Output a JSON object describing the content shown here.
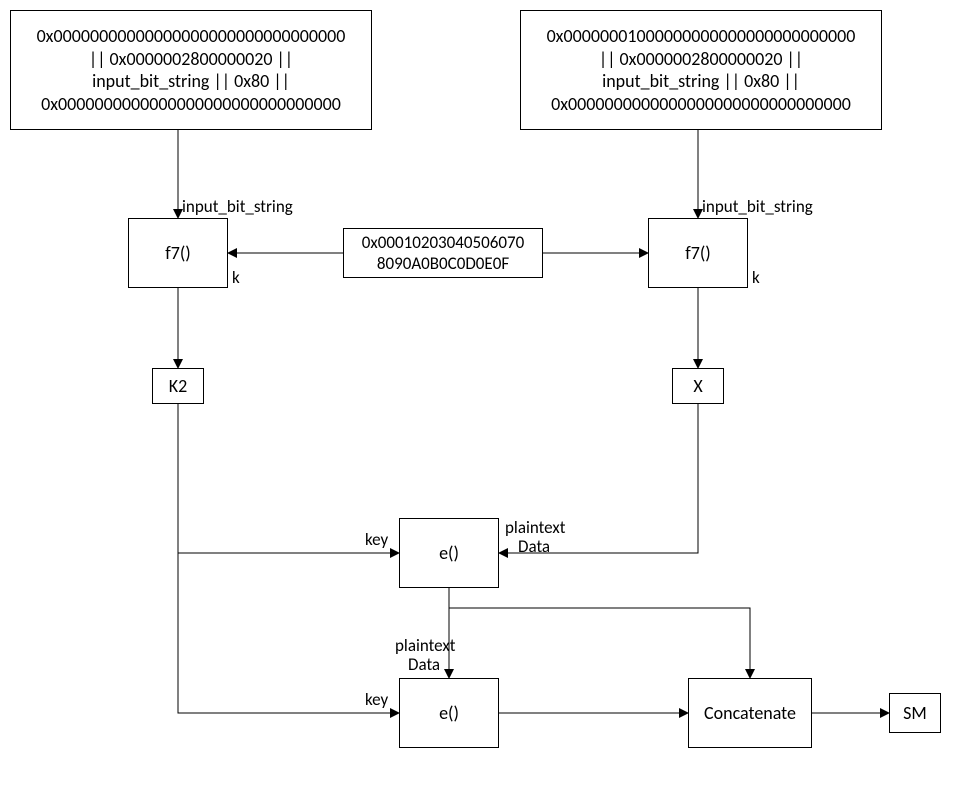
{
  "boxes": {
    "topLeft": {
      "line1": "0x00000000000000000000000000000000",
      "line2": "|| 0x0000002800000020 ||",
      "line3": "input_bit_string || 0x80 ||",
      "line4": "0x0000000000000000000000000000000"
    },
    "topRight": {
      "line1": "0x00000001000000000000000000000000",
      "line2": "|| 0x0000002800000020 ||",
      "line3": "input_bit_string || 0x80 ||",
      "line4": "0x0000000000000000000000000000000"
    },
    "f7Left": "f7()",
    "f7Right": "f7()",
    "keyMid": {
      "line1": "0x00010203040506070",
      "line2": "8090A0B0C0D0E0F"
    },
    "k2": "K2",
    "x": "X",
    "e1": "e()",
    "e2": "e()",
    "concat": "Concatenate",
    "sm": "SM"
  },
  "labels": {
    "ibsLeft": "input_bit_string",
    "ibsRight": "input_bit_string",
    "kLeft": "k",
    "kRight": "k",
    "keyE1": "key",
    "keyE2": "key",
    "ptE1a": "plaintext",
    "ptE1b": "Data",
    "ptE2a": "plaintext",
    "ptE2b": "Data"
  }
}
